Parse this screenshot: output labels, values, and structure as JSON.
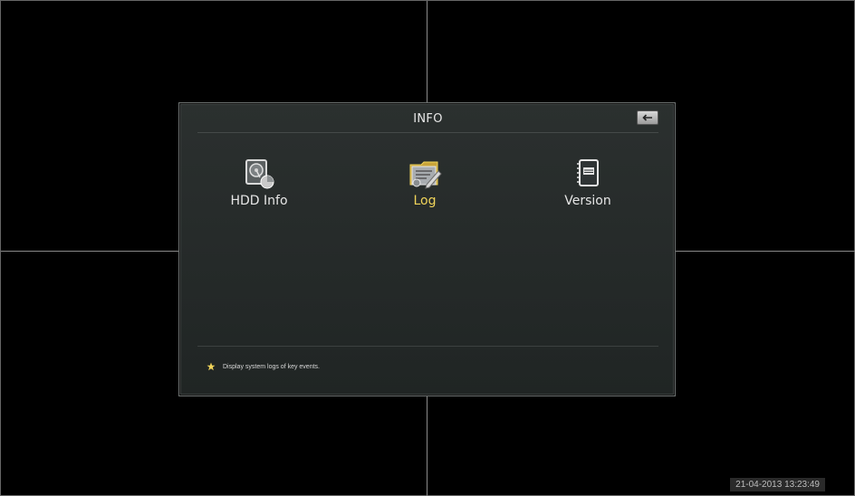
{
  "dialog": {
    "title": "INFO",
    "back_icon": "back-arrow-icon",
    "items": [
      {
        "label": "HDD Info",
        "icon": "hdd-icon",
        "active": false
      },
      {
        "label": "Log",
        "icon": "log-icon",
        "active": true
      },
      {
        "label": "Version",
        "icon": "version-icon",
        "active": false
      }
    ],
    "hint": {
      "icon": "star-icon",
      "text": "Display system logs of key events."
    }
  },
  "status": {
    "timestamp": "21-04-2013 13:23:49"
  },
  "colors": {
    "active_label": "#f0d45a",
    "label": "#e6e6e6",
    "dialog_bg": "#262b2a",
    "background": "#000000"
  }
}
